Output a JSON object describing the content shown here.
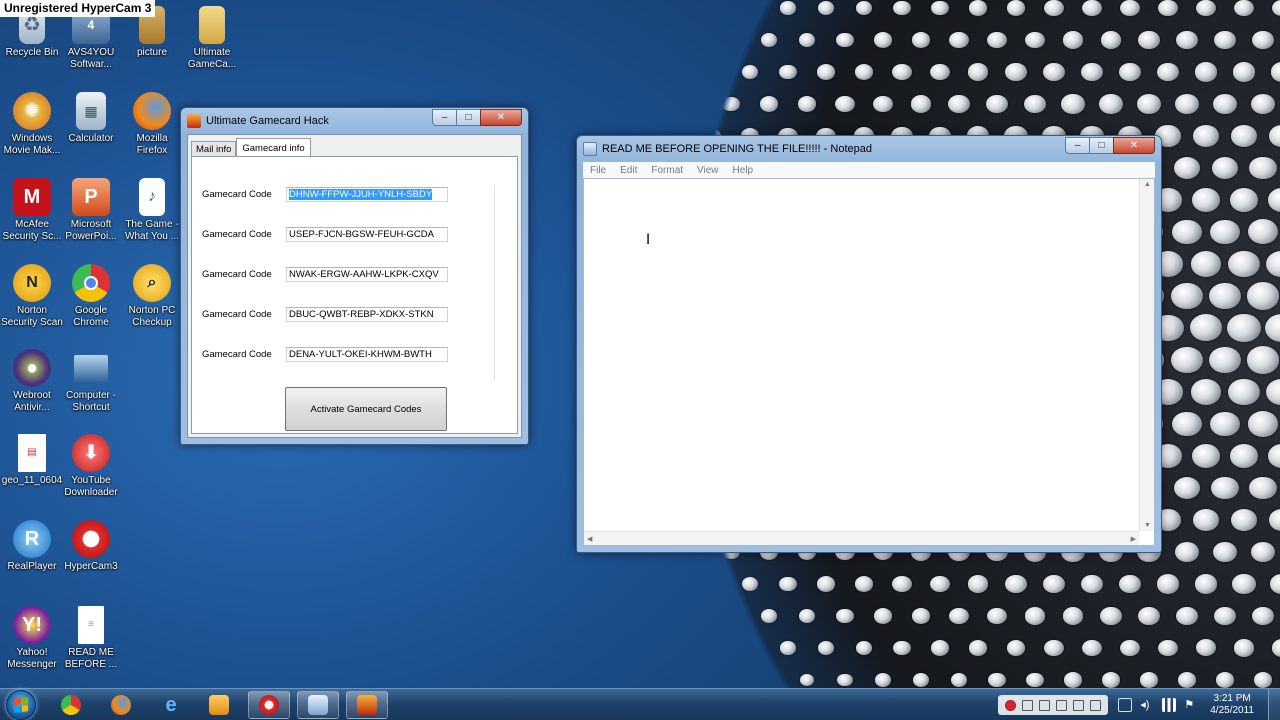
{
  "recorder_watermark": "Unregistered HyperCam 3",
  "desktop_icons": [
    {
      "label": "Recycle Bin"
    },
    {
      "label": "AVS4YOU Softwar..."
    },
    {
      "label": "picture"
    },
    {
      "label": "Ultimate GameCa..."
    },
    {
      "label": "Windows Movie Mak..."
    },
    {
      "label": "Calculator"
    },
    {
      "label": "Mozilla Firefox"
    },
    {
      "label": "McAfee Security Sc..."
    },
    {
      "label": "Microsoft PowerPoi..."
    },
    {
      "label": "The Game - What You ..."
    },
    {
      "label": "Norton Security Scan"
    },
    {
      "label": "Google Chrome"
    },
    {
      "label": "Norton PC Checkup"
    },
    {
      "label": "Webroot Antivir..."
    },
    {
      "label": "Computer - Shortcut"
    },
    {
      "label": "geo_11_0604"
    },
    {
      "label": "YouTube Downloader"
    },
    {
      "label": "RealPlayer"
    },
    {
      "label": "HyperCam3"
    },
    {
      "label": "Yahoo! Messenger"
    },
    {
      "label": "READ ME BEFORE ..."
    }
  ],
  "hack_window": {
    "title": "Ultimate Gamecard Hack",
    "tabs": [
      "Mail info",
      "Gamecard info"
    ],
    "code_label": "Gamecard Code",
    "codes": [
      "DHNW-FFPW-JJUH-YNLH-SBDY",
      "USEP-FJCN-BGSW-FEUH-GCDA",
      "NWAK-ERGW-AAHW-LKPK-CXQV",
      "DBUC-QWBT-REBP-XDKX-STKN",
      "DENA-YULT-OKEI-KHWM-BWTH"
    ],
    "activate_button": "Activate Gamecard Codes"
  },
  "notepad_window": {
    "title": "READ ME BEFORE OPENING THE FILE!!!!! - Notepad",
    "menu": [
      "File",
      "Edit",
      "Format",
      "View",
      "Help"
    ],
    "content": ""
  },
  "window_controls": {
    "minimize": "–",
    "maximize": "□",
    "close": "✕"
  },
  "taskbar": {
    "clock_time": "3:21 PM",
    "clock_date": "4/25/2011"
  }
}
